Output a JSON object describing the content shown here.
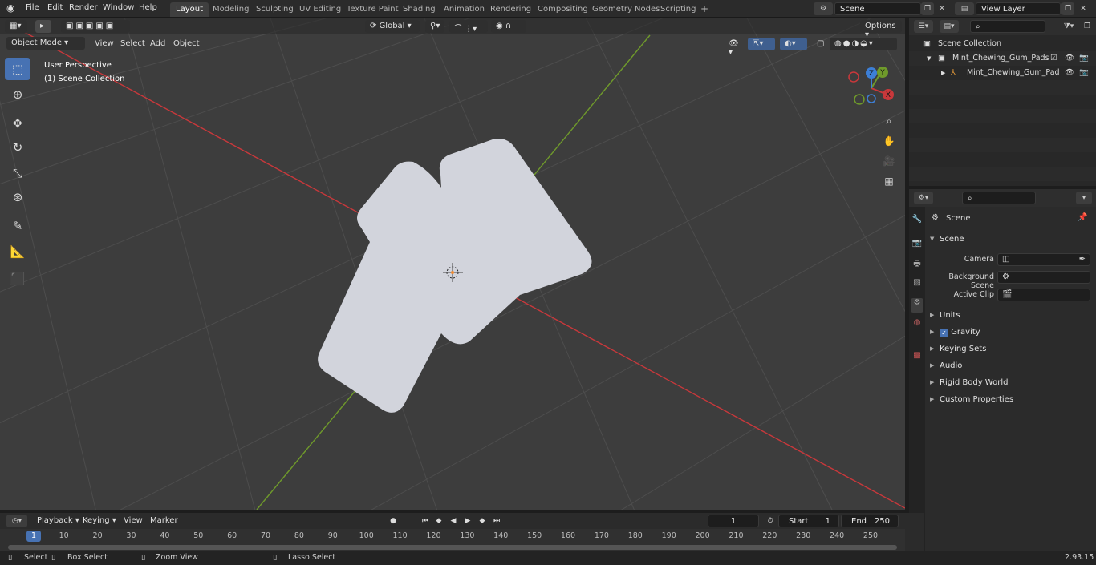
{
  "topbar": {
    "menus": [
      "File",
      "Edit",
      "Render",
      "Window",
      "Help"
    ],
    "workspace_tabs": [
      "Layout",
      "Modeling",
      "Sculpting",
      "UV Editing",
      "Texture Paint",
      "Shading",
      "Animation",
      "Rendering",
      "Compositing",
      "Geometry Nodes",
      "Scripting"
    ],
    "active_tab": "Layout",
    "add_tab": "+",
    "scene_name": "Scene",
    "view_layer": "View Layer"
  },
  "viewport": {
    "mode": "Object Mode",
    "menus": [
      "View",
      "Select",
      "Add",
      "Object"
    ],
    "transform_orientation": "Global",
    "options_label": "Options",
    "perspective_label": "User Perspective",
    "collection_label": "(1) Scene Collection",
    "gizmo_axes": {
      "x": "X",
      "y": "Y",
      "z": "Z"
    },
    "colors": {
      "x_axis": "#c8383b",
      "y_axis": "#6f9a2b",
      "mesh": "#d2d4dc",
      "grid": "#4d4d4d",
      "accent": "#4772b3"
    }
  },
  "outliner": {
    "root": "Scene Collection",
    "items": [
      {
        "label": "Mint_Chewing_Gum_Pads_Wh"
      },
      {
        "label": "Mint_Chewing_Gum_Pad"
      }
    ]
  },
  "properties": {
    "context_label": "Scene",
    "section": "Scene",
    "fields": [
      {
        "label": "Camera"
      },
      {
        "label": "Background Scene"
      },
      {
        "label": "Active Clip"
      }
    ],
    "panels": [
      "Units",
      "Gravity",
      "Keying Sets",
      "Audio",
      "Rigid Body World",
      "Custom Properties"
    ]
  },
  "timeline": {
    "menus": [
      "Playback",
      "Keying",
      "View",
      "Marker"
    ],
    "current_frame": "1",
    "start_label": "Start",
    "start_value": "1",
    "end_label": "End",
    "end_value": "250",
    "ruler": [
      "1",
      "10",
      "20",
      "30",
      "40",
      "50",
      "60",
      "70",
      "80",
      "90",
      "100",
      "110",
      "120",
      "130",
      "140",
      "150",
      "160",
      "170",
      "180",
      "190",
      "200",
      "210",
      "220",
      "230",
      "240",
      "250"
    ]
  },
  "statusbar": {
    "select": "Select",
    "box_select": "Box Select",
    "zoom_view": "Zoom View",
    "lasso_select": "Lasso Select",
    "version": "2.93.15"
  }
}
